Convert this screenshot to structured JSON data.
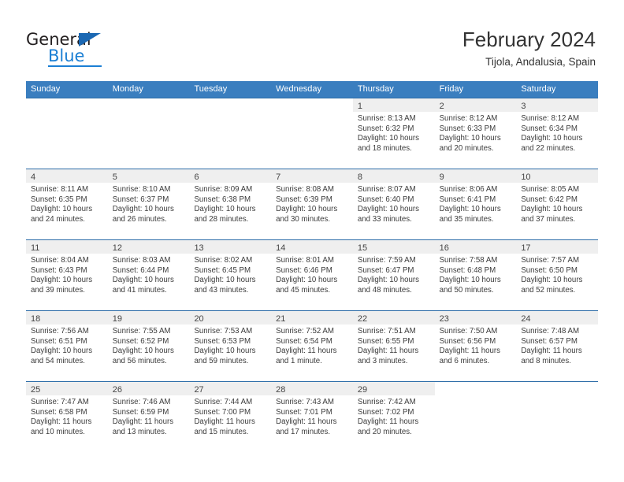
{
  "brand": {
    "name_part1": "General",
    "name_part2": "Blue",
    "triangle_color": "#1b68b3",
    "blue_color": "#1b7fd4"
  },
  "header": {
    "month_title": "February 2024",
    "location": "Tijola, Andalusia, Spain"
  },
  "theme": {
    "header_row_bg": "#3a7ebf",
    "cell_border": "#2c6ca8",
    "day_band_bg": "#efefef"
  },
  "weekdays": [
    "Sunday",
    "Monday",
    "Tuesday",
    "Wednesday",
    "Thursday",
    "Friday",
    "Saturday"
  ],
  "weeks": [
    [
      {
        "day": "",
        "lines": []
      },
      {
        "day": "",
        "lines": []
      },
      {
        "day": "",
        "lines": []
      },
      {
        "day": "",
        "lines": []
      },
      {
        "day": "1",
        "lines": [
          "Sunrise: 8:13 AM",
          "Sunset: 6:32 PM",
          "Daylight: 10 hours",
          "and 18 minutes."
        ]
      },
      {
        "day": "2",
        "lines": [
          "Sunrise: 8:12 AM",
          "Sunset: 6:33 PM",
          "Daylight: 10 hours",
          "and 20 minutes."
        ]
      },
      {
        "day": "3",
        "lines": [
          "Sunrise: 8:12 AM",
          "Sunset: 6:34 PM",
          "Daylight: 10 hours",
          "and 22 minutes."
        ]
      }
    ],
    [
      {
        "day": "4",
        "lines": [
          "Sunrise: 8:11 AM",
          "Sunset: 6:35 PM",
          "Daylight: 10 hours",
          "and 24 minutes."
        ]
      },
      {
        "day": "5",
        "lines": [
          "Sunrise: 8:10 AM",
          "Sunset: 6:37 PM",
          "Daylight: 10 hours",
          "and 26 minutes."
        ]
      },
      {
        "day": "6",
        "lines": [
          "Sunrise: 8:09 AM",
          "Sunset: 6:38 PM",
          "Daylight: 10 hours",
          "and 28 minutes."
        ]
      },
      {
        "day": "7",
        "lines": [
          "Sunrise: 8:08 AM",
          "Sunset: 6:39 PM",
          "Daylight: 10 hours",
          "and 30 minutes."
        ]
      },
      {
        "day": "8",
        "lines": [
          "Sunrise: 8:07 AM",
          "Sunset: 6:40 PM",
          "Daylight: 10 hours",
          "and 33 minutes."
        ]
      },
      {
        "day": "9",
        "lines": [
          "Sunrise: 8:06 AM",
          "Sunset: 6:41 PM",
          "Daylight: 10 hours",
          "and 35 minutes."
        ]
      },
      {
        "day": "10",
        "lines": [
          "Sunrise: 8:05 AM",
          "Sunset: 6:42 PM",
          "Daylight: 10 hours",
          "and 37 minutes."
        ]
      }
    ],
    [
      {
        "day": "11",
        "lines": [
          "Sunrise: 8:04 AM",
          "Sunset: 6:43 PM",
          "Daylight: 10 hours",
          "and 39 minutes."
        ]
      },
      {
        "day": "12",
        "lines": [
          "Sunrise: 8:03 AM",
          "Sunset: 6:44 PM",
          "Daylight: 10 hours",
          "and 41 minutes."
        ]
      },
      {
        "day": "13",
        "lines": [
          "Sunrise: 8:02 AM",
          "Sunset: 6:45 PM",
          "Daylight: 10 hours",
          "and 43 minutes."
        ]
      },
      {
        "day": "14",
        "lines": [
          "Sunrise: 8:01 AM",
          "Sunset: 6:46 PM",
          "Daylight: 10 hours",
          "and 45 minutes."
        ]
      },
      {
        "day": "15",
        "lines": [
          "Sunrise: 7:59 AM",
          "Sunset: 6:47 PM",
          "Daylight: 10 hours",
          "and 48 minutes."
        ]
      },
      {
        "day": "16",
        "lines": [
          "Sunrise: 7:58 AM",
          "Sunset: 6:48 PM",
          "Daylight: 10 hours",
          "and 50 minutes."
        ]
      },
      {
        "day": "17",
        "lines": [
          "Sunrise: 7:57 AM",
          "Sunset: 6:50 PM",
          "Daylight: 10 hours",
          "and 52 minutes."
        ]
      }
    ],
    [
      {
        "day": "18",
        "lines": [
          "Sunrise: 7:56 AM",
          "Sunset: 6:51 PM",
          "Daylight: 10 hours",
          "and 54 minutes."
        ]
      },
      {
        "day": "19",
        "lines": [
          "Sunrise: 7:55 AM",
          "Sunset: 6:52 PM",
          "Daylight: 10 hours",
          "and 56 minutes."
        ]
      },
      {
        "day": "20",
        "lines": [
          "Sunrise: 7:53 AM",
          "Sunset: 6:53 PM",
          "Daylight: 10 hours",
          "and 59 minutes."
        ]
      },
      {
        "day": "21",
        "lines": [
          "Sunrise: 7:52 AM",
          "Sunset: 6:54 PM",
          "Daylight: 11 hours",
          "and 1 minute."
        ]
      },
      {
        "day": "22",
        "lines": [
          "Sunrise: 7:51 AM",
          "Sunset: 6:55 PM",
          "Daylight: 11 hours",
          "and 3 minutes."
        ]
      },
      {
        "day": "23",
        "lines": [
          "Sunrise: 7:50 AM",
          "Sunset: 6:56 PM",
          "Daylight: 11 hours",
          "and 6 minutes."
        ]
      },
      {
        "day": "24",
        "lines": [
          "Sunrise: 7:48 AM",
          "Sunset: 6:57 PM",
          "Daylight: 11 hours",
          "and 8 minutes."
        ]
      }
    ],
    [
      {
        "day": "25",
        "lines": [
          "Sunrise: 7:47 AM",
          "Sunset: 6:58 PM",
          "Daylight: 11 hours",
          "and 10 minutes."
        ]
      },
      {
        "day": "26",
        "lines": [
          "Sunrise: 7:46 AM",
          "Sunset: 6:59 PM",
          "Daylight: 11 hours",
          "and 13 minutes."
        ]
      },
      {
        "day": "27",
        "lines": [
          "Sunrise: 7:44 AM",
          "Sunset: 7:00 PM",
          "Daylight: 11 hours",
          "and 15 minutes."
        ]
      },
      {
        "day": "28",
        "lines": [
          "Sunrise: 7:43 AM",
          "Sunset: 7:01 PM",
          "Daylight: 11 hours",
          "and 17 minutes."
        ]
      },
      {
        "day": "29",
        "lines": [
          "Sunrise: 7:42 AM",
          "Sunset: 7:02 PM",
          "Daylight: 11 hours",
          "and 20 minutes."
        ]
      },
      {
        "day": "",
        "lines": []
      },
      {
        "day": "",
        "lines": []
      }
    ]
  ]
}
